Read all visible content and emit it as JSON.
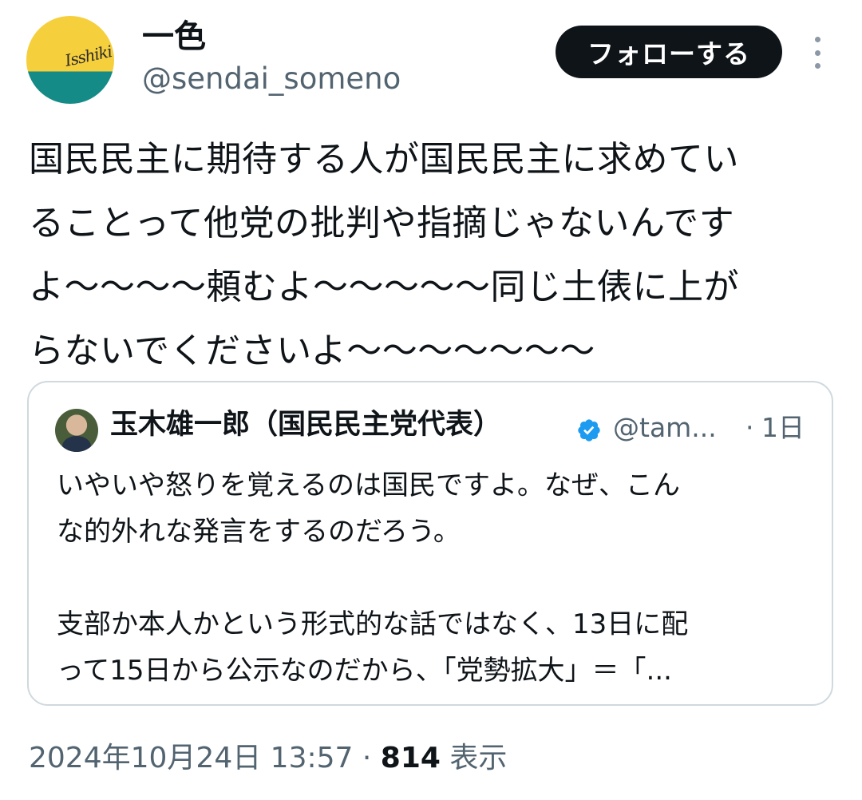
{
  "author": {
    "display_name": "一色",
    "handle": "@sendai_someno",
    "avatar_text": "Isshiki"
  },
  "follow_button_label": "フォローする",
  "more_icon": "more-vertical-icon",
  "tweet_lines": [
    "国民民主に期待する人が国民民主に求めてい",
    "ることって他党の批判や指摘じゃないんです",
    "よ〜〜〜〜頼むよ〜〜〜〜〜同じ土俵に上が",
    "らないでくださいよ〜〜〜〜〜〜〜"
  ],
  "quote": {
    "name": "玉木雄一郎（国民民主党代表）",
    "verified_icon": "verified-badge-icon",
    "handle": "@tam...",
    "separator": "·",
    "time": "1日",
    "lines": [
      "いやいや怒りを覚えるのは国民ですよ。なぜ、こん",
      "な的外れな発言をするのだろう。",
      "",
      "支部か本人かという形式的な話ではなく、13日に配",
      "って15日から公示なのだから、「党勢拡大」＝「..."
    ]
  },
  "meta": {
    "timestamp": "2024年10月24日 13:57",
    "separator": " · ",
    "views_count": "814",
    "views_label": " 表示"
  },
  "colors": {
    "text": "#0f1419",
    "secondary": "#536471",
    "border": "#cfd9de",
    "verified": "#1d9bf0",
    "avatar_yellow": "#f6cf3d",
    "avatar_teal": "#148b87"
  }
}
